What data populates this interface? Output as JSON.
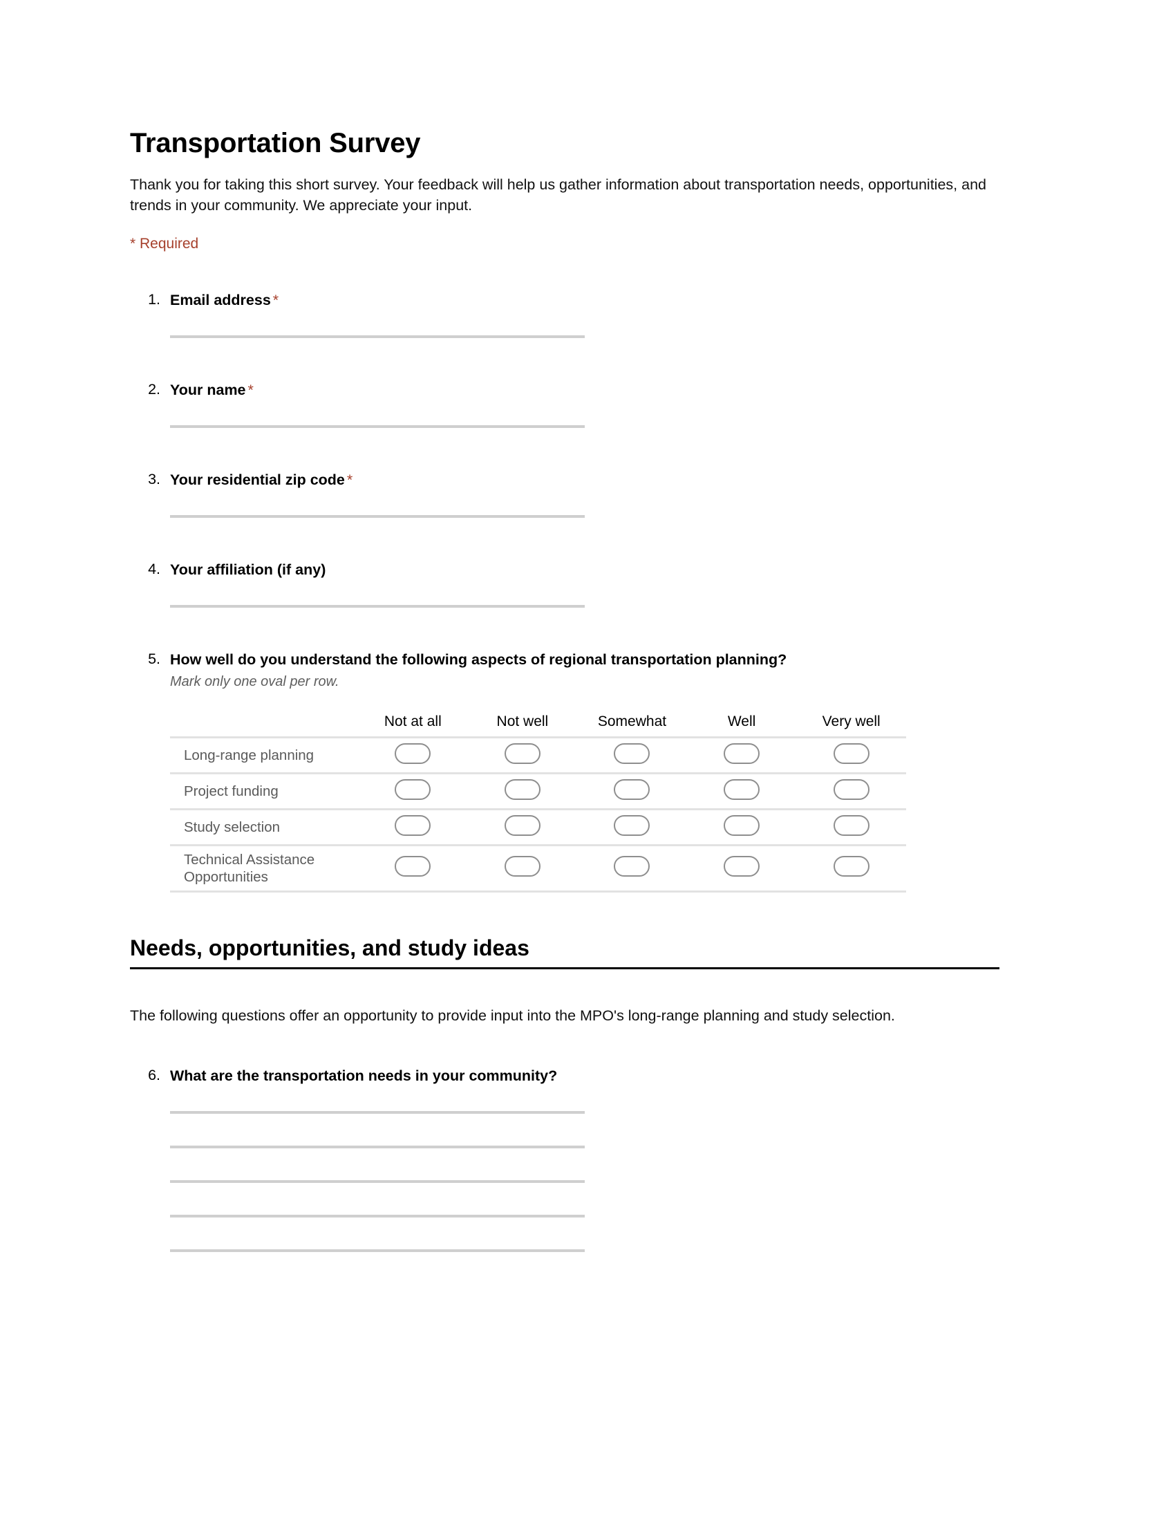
{
  "form": {
    "title": "Transportation Survey",
    "intro": "Thank you for taking this short survey. Your feedback will help us gather information about transportation needs, opportunities, and trends in your community. We appreciate your input.",
    "required_note": "* Required",
    "required_star": "*",
    "accent_color": "#a6402c",
    "line_color": "#cfcfcf",
    "oval_border_color": "#8e8e8e",
    "grid_border_color": "#e2e2e2"
  },
  "questions": [
    {
      "number": "1.",
      "title": "Email address",
      "required": true,
      "type": "short-answer",
      "lines": 1
    },
    {
      "number": "2.",
      "title": "Your name",
      "required": true,
      "type": "short-answer",
      "lines": 1
    },
    {
      "number": "3.",
      "title": "Your residential zip code",
      "required": true,
      "type": "short-answer",
      "lines": 1
    },
    {
      "number": "4.",
      "title": "Your affiliation (if any)",
      "required": false,
      "type": "short-answer",
      "lines": 1
    },
    {
      "number": "5.",
      "title": "How well do you understand the following aspects of regional transportation planning?",
      "required": false,
      "type": "grid",
      "help": "Mark only one oval per row",
      "help_suffix": ".",
      "grid": {
        "columns": [
          "Not at all",
          "Not well",
          "Somewhat",
          "Well",
          "Very well"
        ],
        "rows": [
          "Long-range planning",
          "Project funding",
          "Study selection",
          "Technical Assistance Opportunities"
        ]
      }
    },
    {
      "number": "6.",
      "title": "What are the transportation needs in your community?",
      "required": false,
      "type": "long-answer",
      "lines": 5
    }
  ],
  "section": {
    "title": "Needs, opportunities, and study ideas",
    "body": "The following questions offer an opportunity to provide input into the MPO's long-range planning and study selection."
  }
}
